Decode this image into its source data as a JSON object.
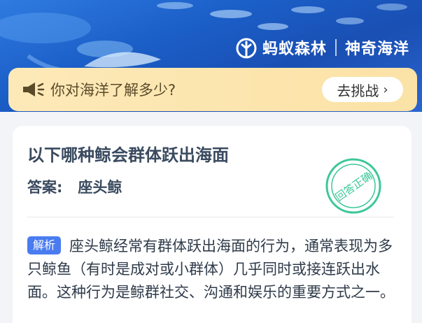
{
  "header": {
    "brand_name": "蚂蚁森林",
    "brand_sub": "神奇海洋",
    "logo_icon": "ant-forest-leaf-icon"
  },
  "quiz_bar": {
    "icon": "megaphone-icon",
    "question": "你对海洋了解多少?",
    "button_label": "去挑战",
    "button_chevron": "›"
  },
  "card": {
    "question": "以下哪种鲸会群体跃出海面",
    "answer_label": "答案:",
    "answer_value": "座头鲸",
    "stamp_text": "回答正确",
    "explain_tag": "解析",
    "explanation": "座头鲸经常有群体跃出海面的行为，通常表现为多只鲸鱼（有时是成对或小群体）几乎同时或接连跃出水面。这种行为是鲸群社交、沟通和娱乐的重要方式之一。"
  },
  "colors": {
    "hero_blue": "#1b5fc8",
    "quiz_bar_yellow": "#fde9b8",
    "tag_blue": "#4a7cf0",
    "stamp_green": "#3cc79a"
  }
}
